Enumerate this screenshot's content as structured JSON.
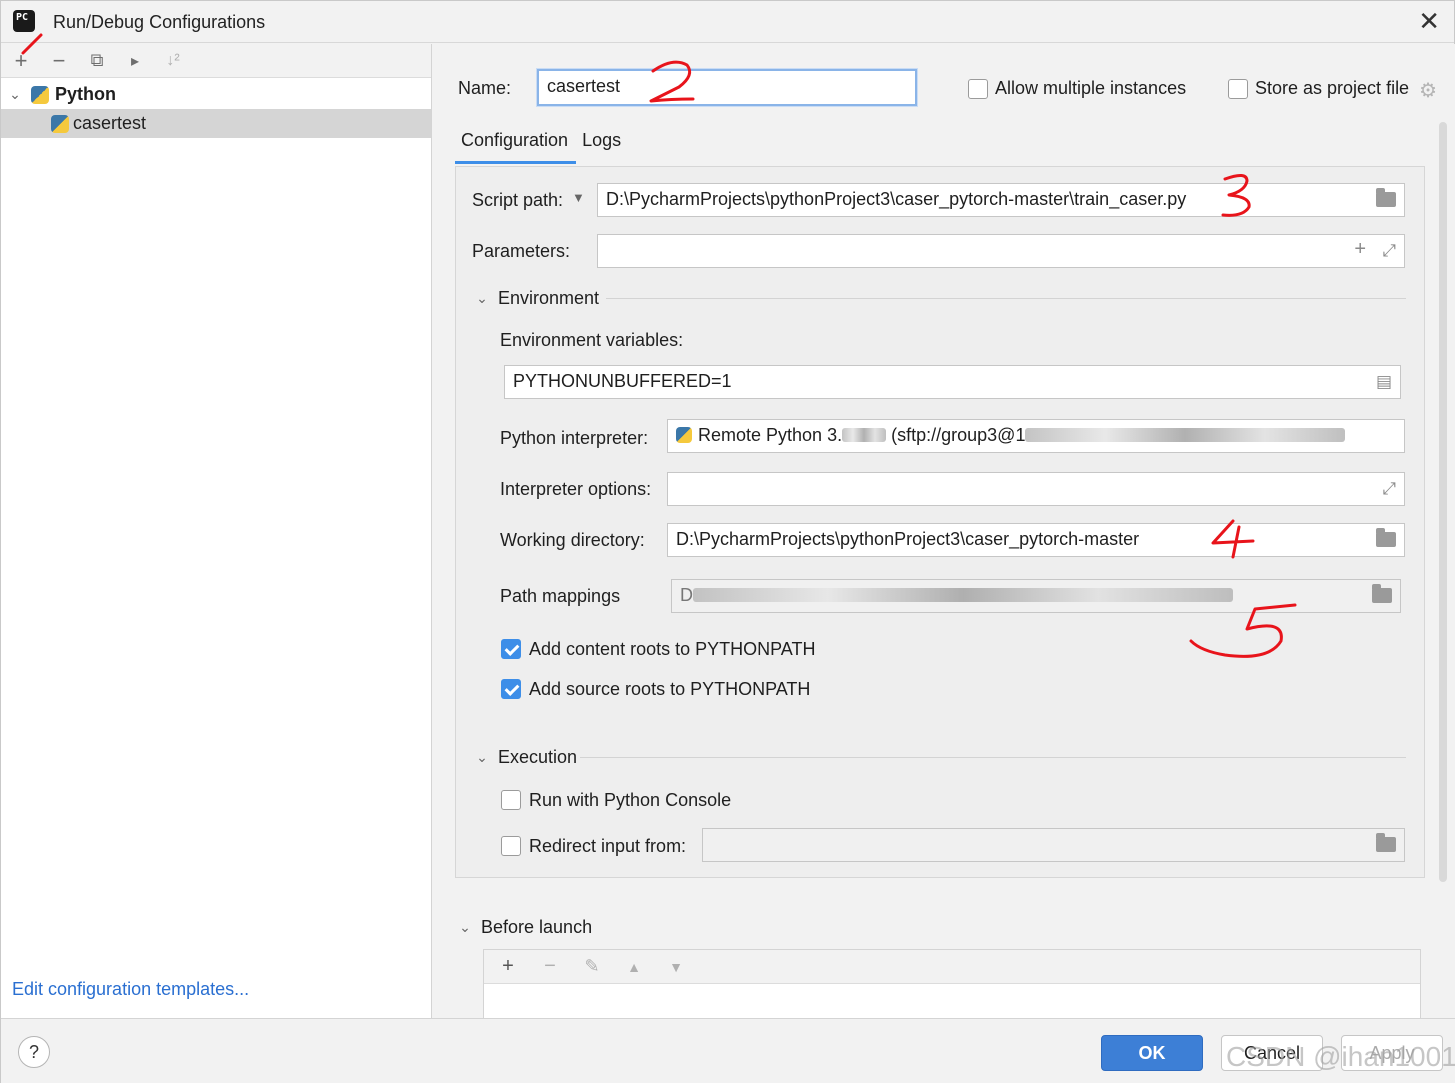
{
  "window": {
    "title": "Run/Debug Configurations",
    "close": "✕"
  },
  "left": {
    "toolbar": {
      "add": "+",
      "remove": "−",
      "copy": "⧉",
      "folder": "▸",
      "sort": "↓²"
    },
    "tree": [
      {
        "label": "Python",
        "expanded": true
      },
      {
        "label": "casertest",
        "selected": true
      }
    ],
    "edit_templates": "Edit configuration templates..."
  },
  "header": {
    "name_label": "Name:",
    "name_value": "casertest",
    "allow_multiple": "Allow multiple instances",
    "store_as_project": "Store as project file"
  },
  "tabs": [
    "Configuration",
    "Logs"
  ],
  "config": {
    "script_path_label": "Script path:",
    "script_path_value": "D:\\PycharmProjects\\pythonProject3\\caser_pytorch-master\\train_caser.py",
    "parameters_label": "Parameters:",
    "parameters_value": "",
    "environment_section": "Environment",
    "env_vars_label": "Environment variables:",
    "env_vars_value": "PYTHONUNBUFFERED=1",
    "interpreter_label": "Python interpreter:",
    "interpreter_value_a": "Remote Python 3.",
    "interpreter_value_b": "(sftp://group3@1",
    "interp_options_label": "Interpreter options:",
    "interp_options_value": "",
    "working_dir_label": "Working directory:",
    "working_dir_value": "D:\\PycharmProjects\\pythonProject3\\caser_pytorch-master",
    "path_mappings_label": "Path mappings",
    "path_mappings_value": "D",
    "add_content_roots": "Add content roots to PYTHONPATH",
    "add_source_roots": "Add source roots to PYTHONPATH",
    "execution_section": "Execution",
    "run_console": "Run with Python Console",
    "redirect_input": "Redirect input from:"
  },
  "before_launch": {
    "label": "Before launch",
    "toolbar": {
      "add": "+",
      "remove": "−",
      "edit": "✎",
      "up": "▲",
      "down": "▼"
    }
  },
  "buttons": {
    "ok": "OK",
    "cancel": "Cancel",
    "apply": "Apply",
    "help": "?"
  },
  "watermark": "CSDN @ihan1001",
  "annotations": [
    "1",
    "2",
    "3",
    "4",
    "5"
  ],
  "colors": {
    "accent": "#3d7fd6",
    "annotation": "#e8141b",
    "link": "#2a6fd1"
  }
}
